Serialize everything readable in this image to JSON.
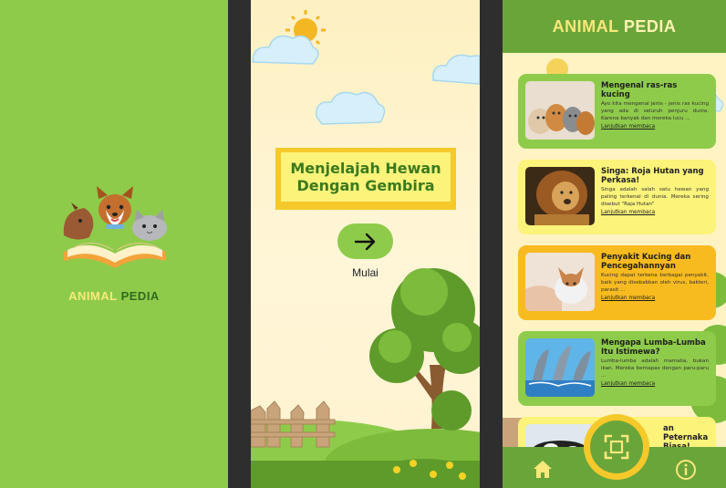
{
  "splash": {
    "brand_part1": "ANIMAL",
    "brand_part2": "PEDIA"
  },
  "welcome": {
    "title_line1": "Menjelajah Hewan",
    "title_line2": "Dengan Gembira",
    "start_icon": "arrow-right-icon",
    "start_label": "Mulai"
  },
  "list": {
    "appbar_part1": "ANIMAL",
    "appbar_part2": "PEDIA",
    "cards": [
      {
        "title": "Mengenal ras-ras kucing",
        "desc": "Ayo kita mengenal jenis - jenis ras kucing yang ada di seluruh penjuru dunia. Karena banyak dan mereka lucu ...",
        "more": "Lanjutkan membaca"
      },
      {
        "title": "Singa: Roja Hutan yang Perkasa!",
        "desc": "Singa adalah salah satu hewan yang paling terkenal di dunia. Mereka sering disebut \"Raja Hutan\"",
        "more": "Lanjutkan membaca"
      },
      {
        "title": "Penyakit Kucing dan Pencegahannyan",
        "desc": "Kucing dapat terkena berbagai penyakit, baik yang disebabkan oleh virus, bakteri, parasit ...",
        "more": "Lanjutkan membaca"
      },
      {
        "title": "Mengapa Lumba-Lumba Itu Istimewa?",
        "desc": "Lumba-lumba adalah mamalia, bukan ikan. Mereka bernapas dengan paru-paru ...",
        "more": "Lanjutkan membaca"
      },
      {
        "title": "an Peternakan Biasa!"
      }
    ],
    "nav": {
      "home_icon": "home-icon",
      "scan_icon": "scan-icon",
      "info_icon": "info-icon"
    }
  },
  "colors": {
    "green": "#8fcb4a",
    "dark_green": "#6aa53a",
    "yellow": "#fbf37a",
    "orange": "#f8bb1f",
    "cream": "#fff3c4"
  }
}
